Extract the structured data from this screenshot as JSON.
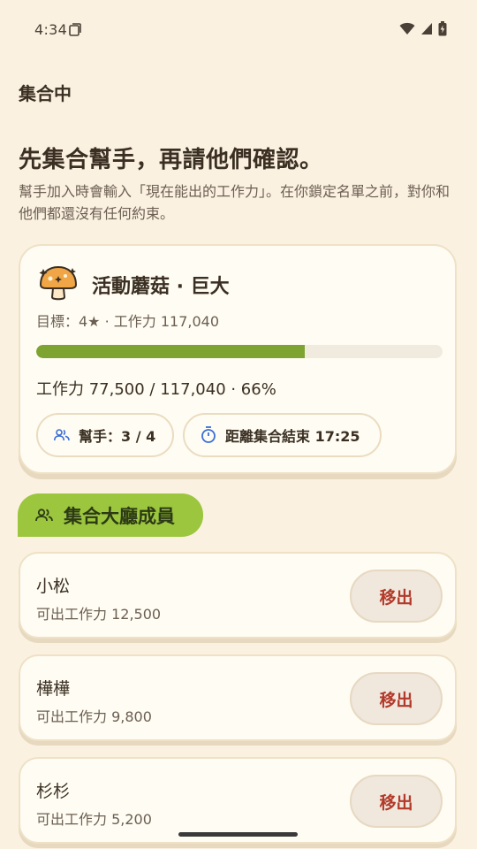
{
  "status_bar": {
    "time": "4:34"
  },
  "screen": {
    "title": "集合中",
    "headline": "先集合幫手，再請他們確認。",
    "subtext": "幫手加入時會輸入「現在能出的工作力」。在你鎖定名單之前，對你和他們都還沒有任何約束。"
  },
  "event": {
    "name": "活動蘑菇 · 巨大",
    "target": "目標：4★ · 工作力 117,040",
    "progress_fraction": 0.66,
    "progress_text": "工作力 77,500 / 117,040 · 66%",
    "helpers_chip": "幫手：3 / 4",
    "timer_chip": "距離集合結束 17:25"
  },
  "members_section": {
    "label": "集合大廳成員"
  },
  "members": [
    {
      "name": "小松",
      "power": "可出工作力 12,500",
      "remove_label": "移出"
    },
    {
      "name": "樺樺",
      "power": "可出工作力 9,800",
      "remove_label": "移出"
    },
    {
      "name": "杉杉",
      "power": "可出工作力 5,200",
      "remove_label": "移出"
    }
  ],
  "colors": {
    "accent": "#9bc63e",
    "progress": "#7da331",
    "danger": "#b23a2a",
    "background": "#fbf1e1"
  },
  "icons": [
    "sim-card-icon",
    "wifi-icon",
    "signal-icon",
    "battery-icon",
    "mushroom-icon",
    "people-icon",
    "timer-icon"
  ]
}
